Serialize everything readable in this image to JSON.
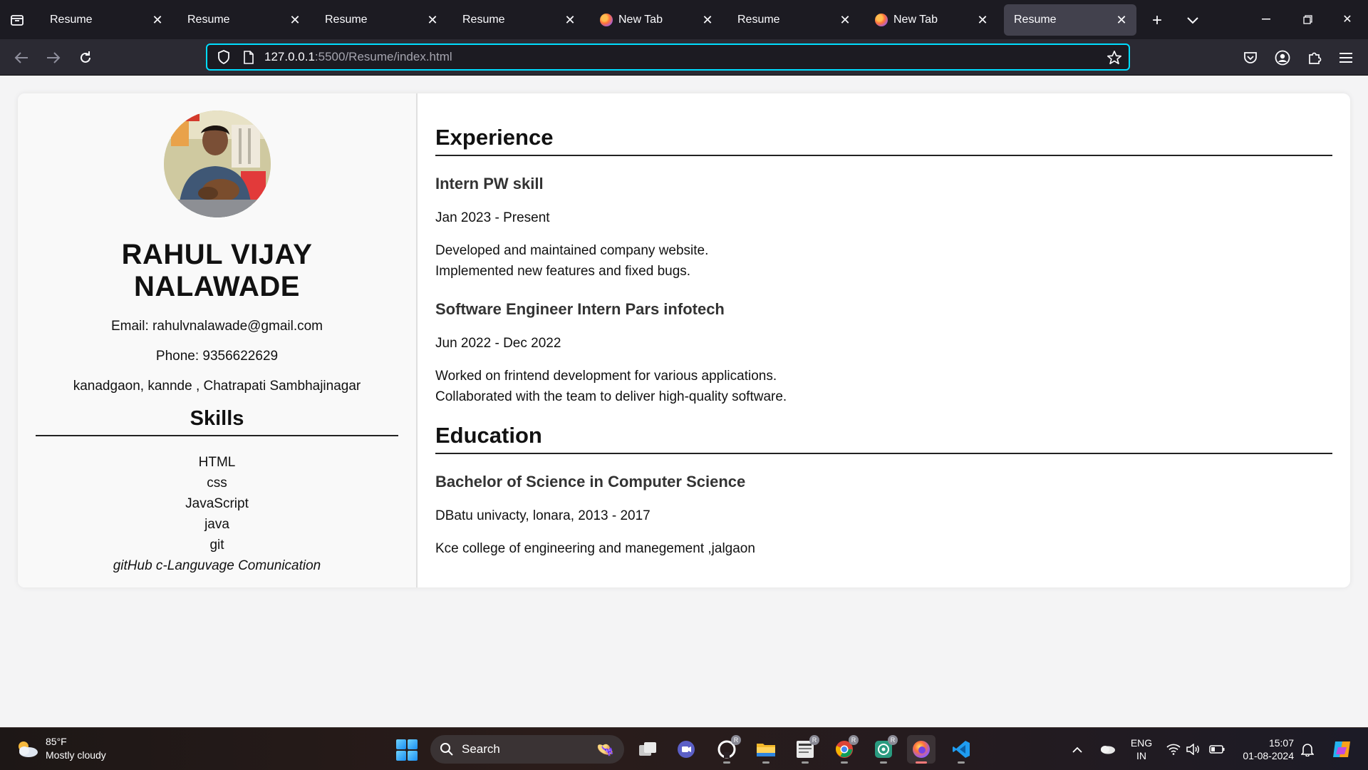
{
  "browser": {
    "tabs": [
      {
        "title": "Resume",
        "favicon": "none",
        "active": false
      },
      {
        "title": "Resume",
        "favicon": "none",
        "active": false
      },
      {
        "title": "Resume",
        "favicon": "none",
        "active": false
      },
      {
        "title": "Resume",
        "favicon": "none",
        "active": false
      },
      {
        "title": "New Tab",
        "favicon": "firefox-icon",
        "active": false
      },
      {
        "title": "Resume",
        "favicon": "none",
        "active": false
      },
      {
        "title": "New Tab",
        "favicon": "firefox-icon",
        "active": false
      },
      {
        "title": "Resume",
        "favicon": "none",
        "active": true
      }
    ],
    "url_host": "127.0.0.1",
    "url_rest": ":5500/Resume/index.html",
    "accent": "#00ddff"
  },
  "resume": {
    "name": "RAHUL VIJAY NALAWADE",
    "email": "Email: rahulvnalawade@gmail.com",
    "phone": "Phone: 9356622629",
    "address": "kanadgaon, kannde , Chatrapati Sambhajinagar",
    "skills_heading": "Skills",
    "skills": [
      "HTML",
      "css",
      "JavaScript",
      "java",
      "git"
    ],
    "skills_extra": "gitHub c-Languvage Comunication",
    "experience_heading": "Experience",
    "jobs": [
      {
        "title": "Intern PW skill",
        "date": "Jan 2023 - Present",
        "lines": [
          "Developed and maintained company website.",
          "Implemented new features and fixed bugs."
        ]
      },
      {
        "title": "Software Engineer Intern Pars infotech",
        "date": "Jun 2022 - Dec 2022",
        "lines": [
          "Worked on frintend development for various applications.",
          "Collaborated with the team to deliver high-quality software."
        ]
      }
    ],
    "education_heading": "Education",
    "degree": "Bachelor of Science in Computer Science",
    "university": "DBatu univacty, lonara, 2013 - 2017",
    "college": "Kce college of engineering and manegement ,jalgaon"
  },
  "taskbar": {
    "weather_temp": "85°F",
    "weather_desc": "Mostly cloudy",
    "search_label": "Search",
    "lang_1": "ENG",
    "lang_2": "IN",
    "time": "15:07",
    "date": "01-08-2024",
    "badge_letter": "R"
  }
}
